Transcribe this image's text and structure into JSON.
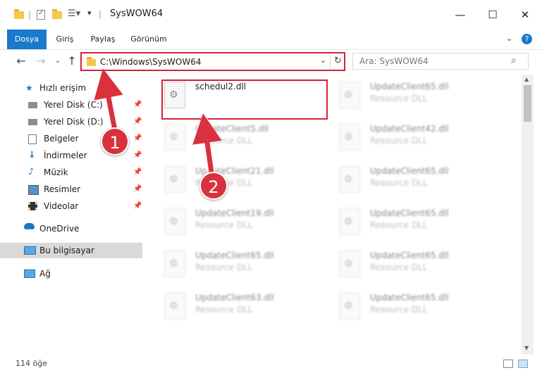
{
  "window": {
    "title": "SysWOW64"
  },
  "ribbon": {
    "tabs": [
      "Dosya",
      "Giriş",
      "Paylaş",
      "Görünüm"
    ]
  },
  "address": {
    "path": "C:\\Windows\\SysWOW64"
  },
  "search": {
    "placeholder": "Ara: SysWOW64"
  },
  "sidebar": {
    "items": [
      {
        "label": "Hızlı erişim",
        "icon": "star-icon"
      },
      {
        "label": "Yerel Disk (C:)",
        "icon": "drive-icon",
        "pinned": true
      },
      {
        "label": "Yerel Disk (D:)",
        "icon": "drive-icon",
        "pinned": true
      },
      {
        "label": "Belgeler",
        "icon": "documents-icon",
        "pinned": true
      },
      {
        "label": "İndirmeler",
        "icon": "download-icon",
        "pinned": true
      },
      {
        "label": "Müzik",
        "icon": "music-icon",
        "pinned": true
      },
      {
        "label": "Resimler",
        "icon": "pictures-icon",
        "pinned": true
      },
      {
        "label": "Videolar",
        "icon": "video-icon",
        "pinned": true
      },
      {
        "label": "OneDrive",
        "icon": "cloud-icon"
      },
      {
        "label": "Bu bilgisayar",
        "icon": "computer-icon",
        "selected": true
      },
      {
        "label": "Ağ",
        "icon": "network-icon"
      }
    ]
  },
  "files": [
    {
      "name": "schedul2.dll",
      "type": ""
    },
    {
      "name": "UpdateClient65.dll",
      "type": "Resource DLL"
    },
    {
      "name": "UpdateClient5.dll",
      "type": "Resource DLL"
    },
    {
      "name": "UpdateClient42.dll",
      "type": "Resource DLL"
    },
    {
      "name": "UpdateClient21.dll",
      "type": "Resource DLL"
    },
    {
      "name": "UpdateClient65.dll",
      "type": "Resource DLL"
    },
    {
      "name": "UpdateClient19.dll",
      "type": "Resource DLL"
    },
    {
      "name": "UpdateClient65.dll",
      "type": "Resource DLL"
    },
    {
      "name": "UpdateClient65.dll",
      "type": "Resource DLL"
    },
    {
      "name": "UpdateClient65.dll",
      "type": "Resource DLL"
    },
    {
      "name": "UpdateClient63.dll",
      "type": "Resource DLL"
    },
    {
      "name": "UpdateClient65.dll",
      "type": "Resource DLL"
    }
  ],
  "status": {
    "count": "114 öğe"
  },
  "callouts": [
    "1",
    "2"
  ],
  "colors": {
    "accent": "#1979ca",
    "highlight": "#d2233a"
  }
}
